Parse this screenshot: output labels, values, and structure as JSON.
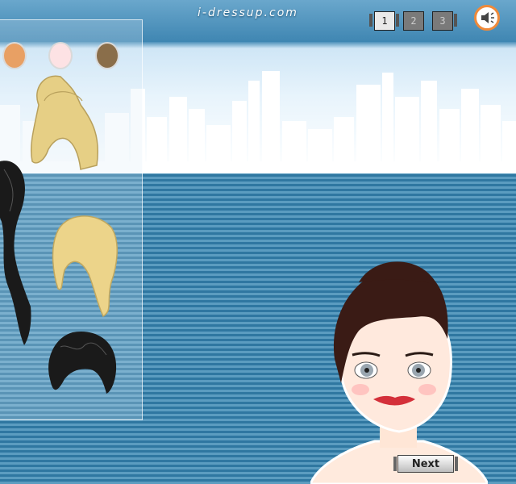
{
  "header": {
    "site_logo": "i-dressup.com",
    "steps": [
      "1",
      "2",
      "3"
    ],
    "active_step": "1"
  },
  "skin_swatches": [
    {
      "name": "tan",
      "color": "#e8a064"
    },
    {
      "name": "pink",
      "color": "#fde2e4"
    },
    {
      "name": "brown",
      "color": "#8a6e4a"
    }
  ],
  "hair_options": [
    {
      "name": "blonde-updo",
      "color": "#e6cf85"
    },
    {
      "name": "black-long-wavy",
      "color": "#1a1a1a"
    },
    {
      "name": "blonde-side-ponytail",
      "color": "#ecd48a"
    },
    {
      "name": "black-curly-short",
      "color": "#1a1a1a"
    }
  ],
  "next_button": {
    "label": "Next"
  },
  "colors": {
    "accent": "#f08a3a",
    "background": "#2f77a1"
  }
}
